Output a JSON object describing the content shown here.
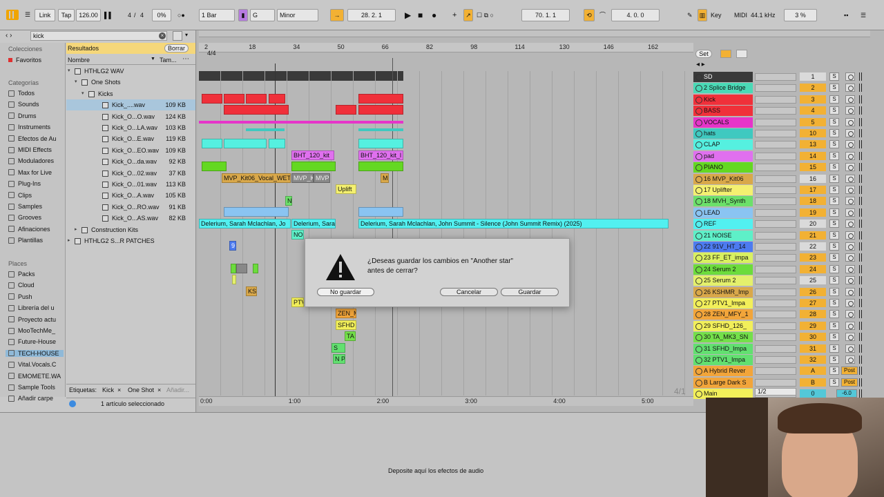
{
  "toolbar": {
    "link": "Link",
    "tap": "Tap",
    "tempo": "126.00",
    "sig_num": "4",
    "sig_den": "4",
    "groove": "0%",
    "quantize": "1 Bar",
    "key": "G",
    "scale": "Minor",
    "position": "28.   2.   1",
    "loop_start": "70.   1.   1",
    "loop_len": "4.   0.   0",
    "key_btn": "Key",
    "midi_btn": "MIDI",
    "sample_rate": "44.1 kHz",
    "cpu": "3 %"
  },
  "browser": {
    "search": "kick",
    "collections_header": "Colecciones",
    "favorites": "Favoritos",
    "categories_header": "Categorías",
    "categories": [
      "Todos",
      "Sounds",
      "Drums",
      "Instruments",
      "Efectos de Au",
      "MIDI Effects",
      "Moduladores",
      "Max for Live",
      "Plug-Ins",
      "Clips",
      "Samples",
      "Grooves",
      "Afinaciones",
      "Plantillas"
    ],
    "places_header": "Places",
    "places": [
      "Packs",
      "Cloud",
      "Push",
      "Librería del u",
      "Proyecto actu",
      "MooTechMe_",
      "Future-House",
      "TECH-HOUSE",
      "Vital.Vocals.C",
      "EMOMETE.WA",
      "Sample Tools",
      "Añadir carpe"
    ],
    "results_label": "Resultados",
    "clear_label": "Borrar",
    "col_name": "Nombre",
    "col_size": "Tam...",
    "tree": [
      {
        "label": "HTHLG2 WAV",
        "size": ""
      },
      {
        "label": "One Shots",
        "size": ""
      },
      {
        "label": "Kicks",
        "size": ""
      },
      {
        "label": "Kick_....wav",
        "size": "109 KB"
      },
      {
        "label": "Kick_O...O.wav",
        "size": "124 KB"
      },
      {
        "label": "Kick_O...LA.wav",
        "size": "103 KB"
      },
      {
        "label": "Kick_O...E.wav",
        "size": "119 KB"
      },
      {
        "label": "Kick_O...EO.wav",
        "size": "109 KB"
      },
      {
        "label": "Kick_O...da.wav",
        "size": "92 KB"
      },
      {
        "label": "Kick_O...02.wav",
        "size": "37 KB"
      },
      {
        "label": "Kick_O...01.wav",
        "size": "113 KB"
      },
      {
        "label": "Kick_O...A.wav",
        "size": "105 KB"
      },
      {
        "label": "Kick_O...RO.wav",
        "size": "91 KB"
      },
      {
        "label": "Kick_O...AS.wav",
        "size": "82 KB"
      },
      {
        "label": "Construction Kits",
        "size": ""
      },
      {
        "label": "HTHLG2 S...R PATCHES",
        "size": ""
      }
    ],
    "tags_label": "Etiquetas:",
    "tag1": "Kick",
    "tag2": "One Shot",
    "tag_add": "Añadir...",
    "status": "1 artículo seleccionado"
  },
  "arrangement": {
    "sig": "4/4",
    "ruler_bars": [
      "2",
      "18",
      "34",
      "50",
      "66",
      "82",
      "98",
      "114",
      "130",
      "146",
      "162"
    ],
    "time_marks": [
      "0:00",
      "1:00",
      "2:00",
      "3:00",
      "4:00",
      "5:00"
    ],
    "set_label": "Set",
    "page_indicator": "4/1",
    "clips": {
      "bht1": "BHT_120_kit",
      "bht2": "BHT_120_kit_l",
      "mvp1": "MVP_Kit06_Vocal_WET",
      "mvp2": "MVP_K",
      "mvp3": "MVP",
      "m": "M",
      "uplift": "Uplift",
      "n": "N",
      "ref1": "Delerium, Sarah Mclachlan, Jo",
      "ref2": "Delerium, Sara",
      "ref3": "Delerium, Sarah Mclachlan, John Summit - Silence (John Summit Remix) (2025)",
      "no": "NO",
      "nine": "9",
      "ks": "KS",
      "ptv": "PTV",
      "zen": "ZEN_M",
      "sfhd": "SFHD",
      "ta": "TA",
      "s": "S",
      "np": "N P"
    }
  },
  "tracks": [
    {
      "name": "SD",
      "num": "1",
      "color": "#3a3a3a",
      "text": "#ffffff"
    },
    {
      "name": "2 Splice Bridge",
      "num": "2",
      "color": "#4ad9b6",
      "text": "#111"
    },
    {
      "name": "Kick",
      "num": "3",
      "color": "#f0303a",
      "text": "#111"
    },
    {
      "name": "BASS",
      "num": "4",
      "color": "#f0303a",
      "text": "#111"
    },
    {
      "name": "VOCALS",
      "num": "5",
      "color": "#e634c9",
      "text": "#111"
    },
    {
      "name": "hats",
      "num": "10",
      "color": "#3fc9c0",
      "text": "#111"
    },
    {
      "name": "CLAP",
      "num": "13",
      "color": "#55f0e0",
      "text": "#111"
    },
    {
      "name": "pad",
      "num": "14",
      "color": "#e070ef",
      "text": "#111"
    },
    {
      "name": "PIANO",
      "num": "15",
      "color": "#64d822",
      "text": "#111"
    },
    {
      "name": "16 MVP_Kit06",
      "num": "16",
      "color": "#d9a84a",
      "text": "#111"
    },
    {
      "name": "17 Uplifter",
      "num": "17",
      "color": "#f4f070",
      "text": "#111"
    },
    {
      "name": "18 MVH_Synth",
      "num": "18",
      "color": "#6ce06a",
      "text": "#111"
    },
    {
      "name": "LEAD",
      "num": "19",
      "color": "#8ac4f2",
      "text": "#111"
    },
    {
      "name": "REF",
      "num": "20",
      "color": "#52f0f0",
      "text": "#111"
    },
    {
      "name": "21 NOISE",
      "num": "21",
      "color": "#5ef0c8",
      "text": "#111"
    },
    {
      "name": "22 91V_HT_14",
      "num": "22",
      "color": "#4d7bf0",
      "text": "#111"
    },
    {
      "name": "23 FF_ET_impa",
      "num": "23",
      "color": "#d9f060",
      "text": "#111"
    },
    {
      "name": "24 Serum 2",
      "num": "24",
      "color": "#6cdc3c",
      "text": "#111"
    },
    {
      "name": "25 Serum 2",
      "num": "25",
      "color": "#e4f06c",
      "text": "#111"
    },
    {
      "name": "26 KSHMR_Imp",
      "num": "26",
      "color": "#d9a84a",
      "text": "#111"
    },
    {
      "name": "27 PTV1_Impa",
      "num": "27",
      "color": "#f2ef5a",
      "text": "#111"
    },
    {
      "name": "28 ZEN_MFY_1",
      "num": "28",
      "color": "#f2a53a",
      "text": "#111"
    },
    {
      "name": "29 SFHD_126_",
      "num": "29",
      "color": "#f2ef5a",
      "text": "#111"
    },
    {
      "name": "30 TA_MK3_SN",
      "num": "30",
      "color": "#74e04a",
      "text": "#111"
    },
    {
      "name": "31 SFHD_Impa",
      "num": "31",
      "color": "#62e070",
      "text": "#111"
    },
    {
      "name": "32 PTV1_Impa",
      "num": "32",
      "color": "#62e070",
      "text": "#111"
    },
    {
      "name": "A Hybrid Rever",
      "num": "A",
      "color": "#f2a53a",
      "text": "#111"
    },
    {
      "name": "B Large Dark S",
      "num": "B",
      "color": "#f2a53a",
      "text": "#111"
    },
    {
      "name": "Main",
      "num": "0",
      "color": "#f2ef5a",
      "text": "#111"
    }
  ],
  "returns": {
    "post": "Post",
    "s": "S"
  },
  "main": {
    "routing": "1/2",
    "vol": "-6.0"
  },
  "dialog": {
    "message_line1": "¿Deseas guardar los cambios en \"Another star\"",
    "message_line2": "antes de cerrar?",
    "dont_save": "No guardar",
    "cancel": "Cancelar",
    "save": "Guardar"
  },
  "bottom": {
    "drop_hint": "Deposite aquí los efectos de audio"
  }
}
